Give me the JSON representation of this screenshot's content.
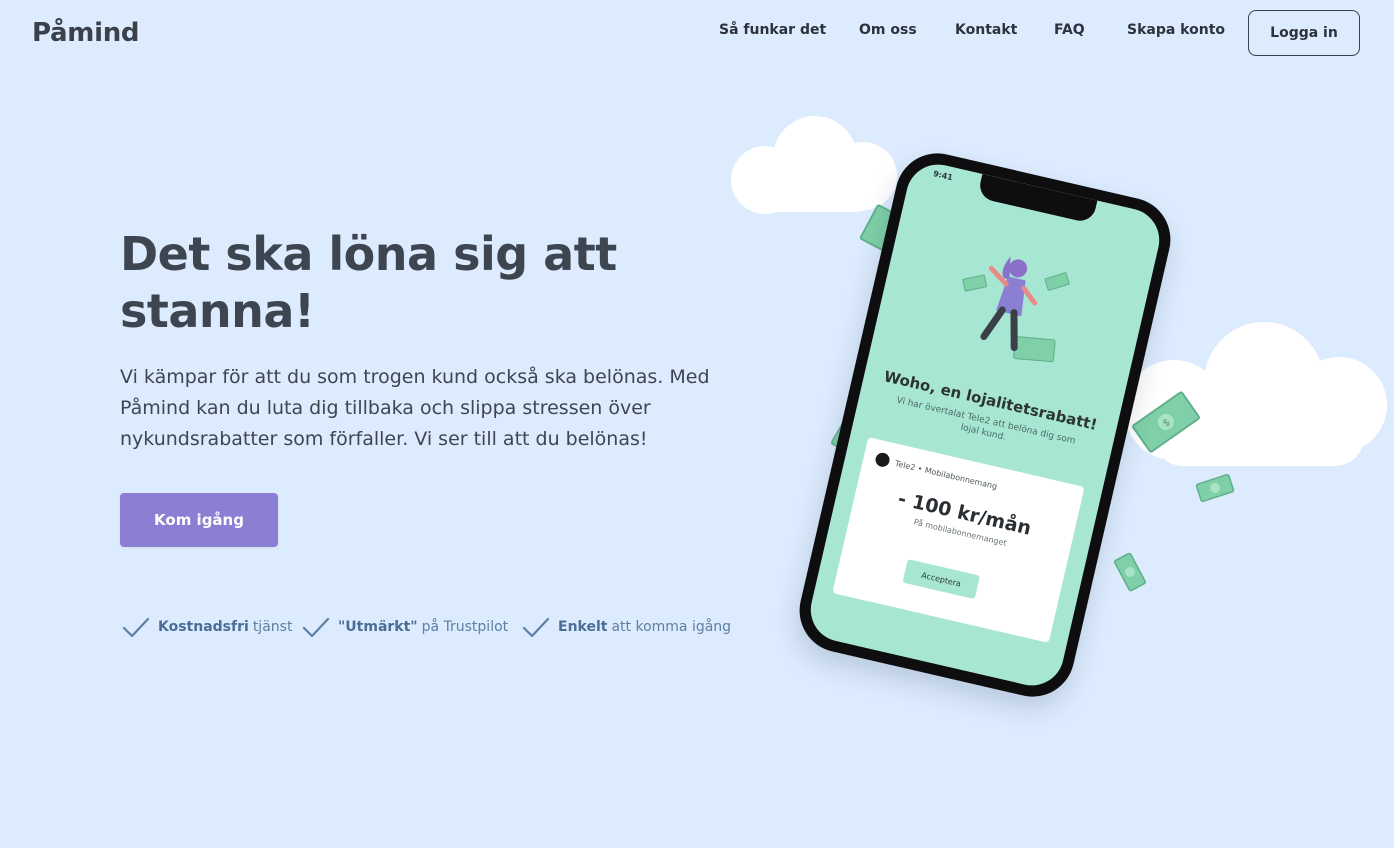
{
  "header": {
    "logo": "Påmind",
    "nav": [
      {
        "label": "Så funkar det"
      },
      {
        "label": "Om oss"
      },
      {
        "label": "Kontakt"
      },
      {
        "label": "FAQ"
      },
      {
        "label": "Skapa konto"
      }
    ],
    "login_label": "Logga in"
  },
  "hero": {
    "headline": "Det ska löna sig att stanna!",
    "intro": "Vi kämpar för att du som trogen kund också ska belönas. Med Påmind kan du luta dig tillbaka och slippa stressen över nykundsrabatter som förfaller. Vi ser till att du belönas!",
    "cta_label": "Kom igång",
    "features": [
      {
        "bold": "Kostnadsfri",
        "rest": "tjänst"
      },
      {
        "bold": "\"Utmärkt\"",
        "rest": "på Trustpilot"
      },
      {
        "bold": "Enkelt",
        "rest": "att komma igång"
      }
    ]
  },
  "phone": {
    "time": "9:41",
    "title": "Woho, en lojalitetsrabatt!",
    "subtitle": "Vi har övertalat Tele2 att belöna dig som lojal kund.",
    "ticket_label": "Tele2 • Mobilabonnemang",
    "amount": "- 100 kr/mån",
    "period": "På mobilabonnemanget",
    "accept_label": "Acceptera"
  },
  "colors": {
    "background": "#dcebfd",
    "accent": "#8b7fd3",
    "mint": "#a8e6d4",
    "text": "#3d4551",
    "feature_text": "#5f7fa3"
  },
  "icons": {
    "feature_check": "check-icon",
    "money": "banknote-icon"
  }
}
